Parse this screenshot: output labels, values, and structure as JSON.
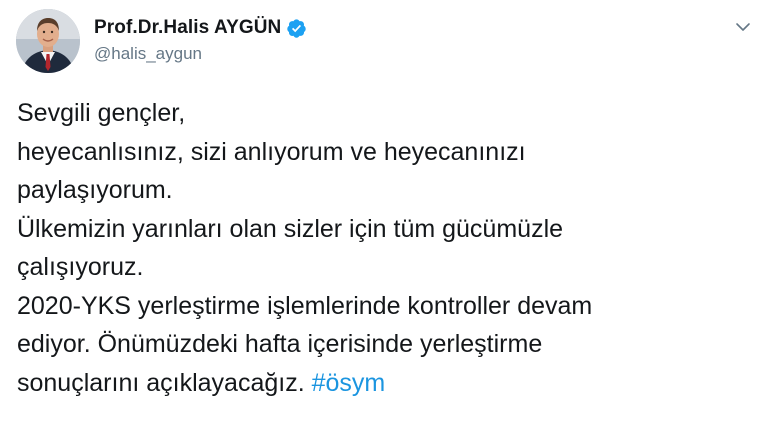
{
  "author": {
    "display_name": "Prof.Dr.Halis AYGÜN",
    "handle": "@halis_aygun",
    "verified": true
  },
  "icons": {
    "avatar": "profile-photo",
    "verified": "verified-badge-icon",
    "menu": "chevron-down-icon"
  },
  "colors": {
    "text": "#14171a",
    "secondary": "#657786",
    "link": "#1b95e0",
    "verified": "#1da1f2"
  },
  "tweet": {
    "lines": [
      "Sevgili gençler,",
      "heyecanlısınız, sizi anlıyorum ve heyecanınızı",
      "paylaşıyorum.",
      "Ülkemizin yarınları olan sizler için tüm gücümüzle",
      "çalışıyoruz.",
      "2020-YKS yerleştirme işlemlerinde kontroller devam",
      "ediyor. Önümüzdeki hafta içerisinde yerleştirme",
      "sonuçlarını açıklayacağız."
    ],
    "hashtag": "#ösym"
  }
}
